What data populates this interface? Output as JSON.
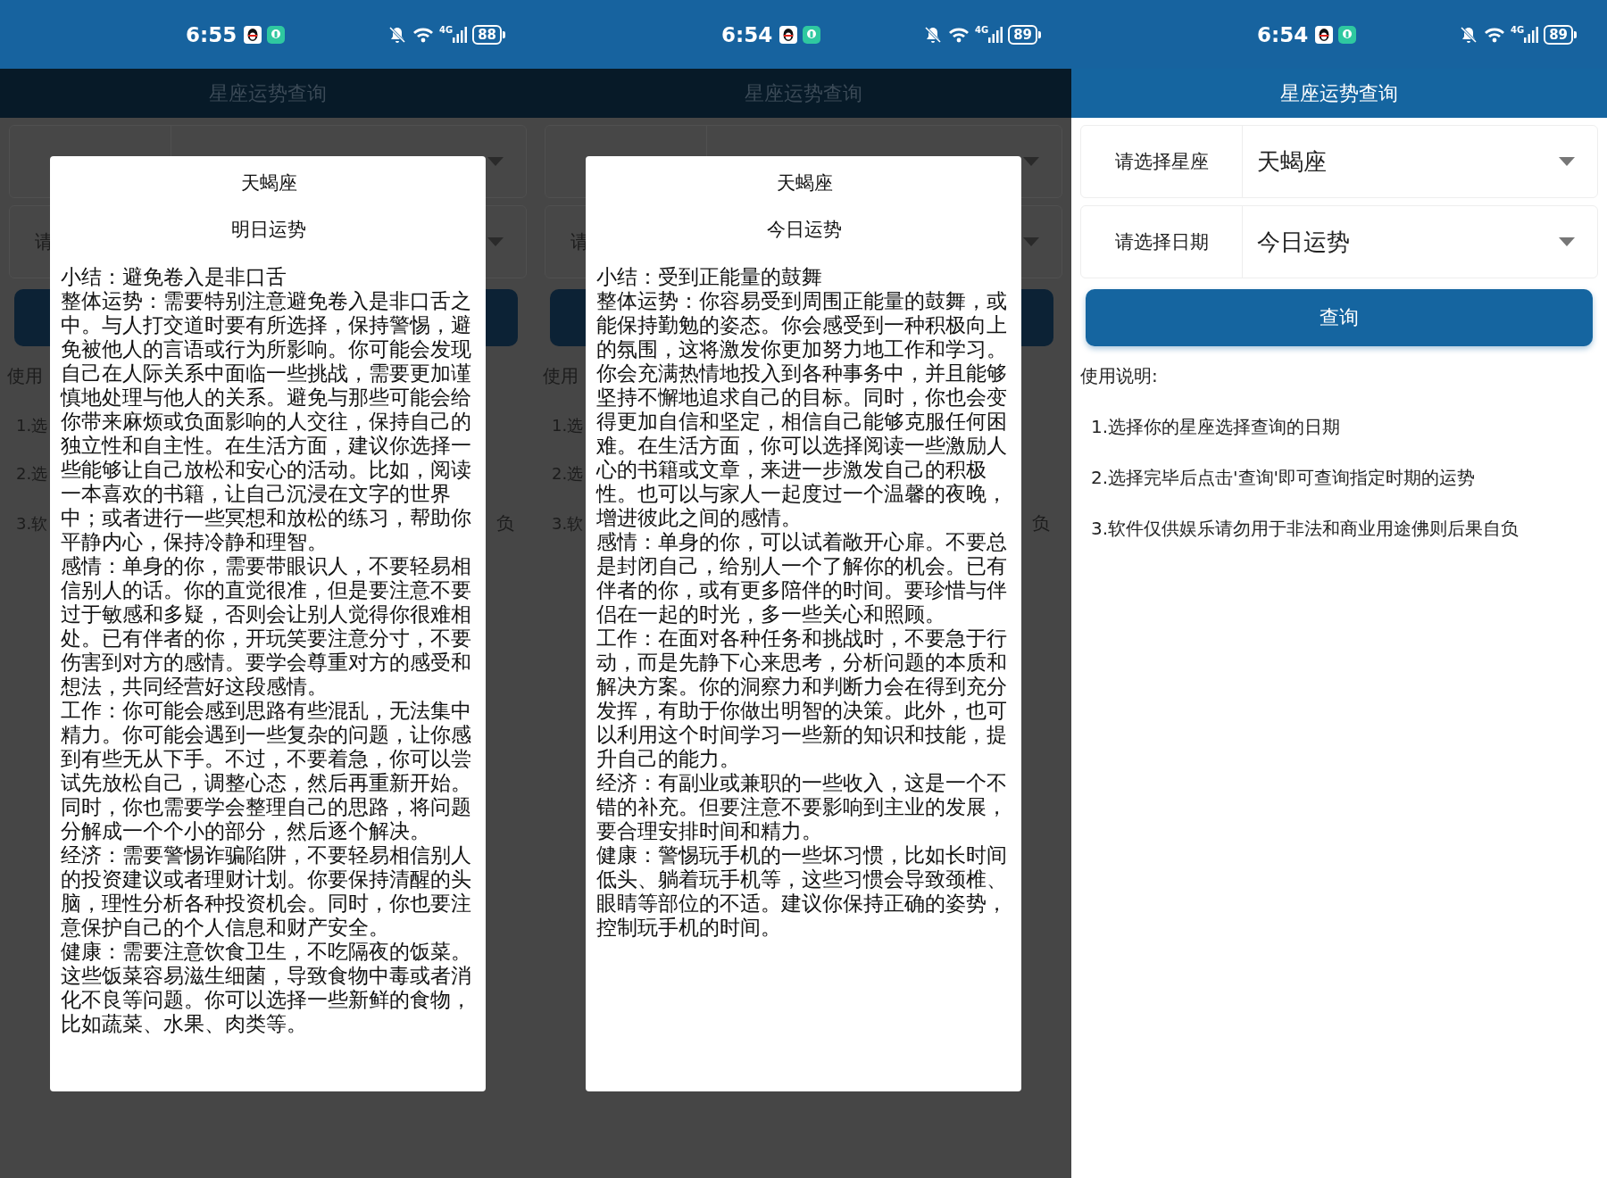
{
  "screens": [
    {
      "kind": "dialog",
      "status_bar": {
        "time": "6:55",
        "network": "4G",
        "battery": "88"
      },
      "header": {
        "title": "星座运势查询"
      },
      "background": {
        "field_fragment": "请",
        "usage_fragment": "使用",
        "item_fragments": [
          "1.选",
          "2.选",
          "3.软"
        ],
        "item_tail": "负"
      },
      "dialog": {
        "title": "天蝎座",
        "period": "明日运势",
        "paragraphs": [
          "小结：避免卷入是非口舌",
          "整体运势：需要特别注意避免卷入是非口舌之中。与人打交道时要有所选择，保持警惕，避免被他人的言语或行为所影响。你可能会发现自己在人际关系中面临一些挑战，需要更加谨慎地处理与他人的关系。避免与那些可能会给你带来麻烦或负面影响的人交往，保持自己的独立性和自主性。在生活方面，建议你选择一些能够让自己放松和安心的活动。比如，阅读一本喜欢的书籍，让自己沉浸在文字的世界中；或者进行一些冥想和放松的练习，帮助你平静内心，保持冷静和理智。",
          "感情：单身的你，需要带眼识人，不要轻易相信别人的话。你的直觉很准，但是要注意不要过于敏感和多疑，否则会让别人觉得你很难相处。已有伴者的你，开玩笑要注意分寸，不要伤害到对方的感情。要学会尊重对方的感受和想法，共同经营好这段感情。",
          "工作：你可能会感到思路有些混乱，无法集中精力。你可能会遇到一些复杂的问题，让你感到有些无从下手。不过，不要着急，你可以尝试先放松自己，调整心态，然后再重新开始。同时，你也需要学会整理自己的思路，将问题分解成一个个小的部分，然后逐个解决。",
          "经济：需要警惕诈骗陷阱，不要轻易相信别人的投资建议或者理财计划。你要保持清醒的头脑，理性分析各种投资机会。同时，你也要注意保护自己的个人信息和财产安全。",
          "健康：需要注意饮食卫生，不吃隔夜的饭菜。这些饭菜容易滋生细菌，导致食物中毒或者消化不良等问题。你可以选择一些新鲜的食物，比如蔬菜、水果、肉类等。"
        ]
      }
    },
    {
      "kind": "dialog",
      "status_bar": {
        "time": "6:54",
        "network": "4G",
        "battery": "89"
      },
      "header": {
        "title": "星座运势查询"
      },
      "background": {
        "field_fragment": "请",
        "usage_fragment": "使用",
        "item_fragments": [
          "1.选",
          "2.选",
          "3.软"
        ],
        "item_tail": "负"
      },
      "dialog": {
        "title": "天蝎座",
        "period": "今日运势",
        "paragraphs": [
          "小结：受到正能量的鼓舞",
          "整体运势：你容易受到周围正能量的鼓舞，或能保持勤勉的姿态。你会感受到一种积极向上的氛围，这将激发你更加努力地工作和学习。你会充满热情地投入到各种事务中，并且能够坚持不懈地追求自己的目标。同时，你也会变得更加自信和坚定，相信自己能够克服任何困难。在生活方面，你可以选择阅读一些激励人心的书籍或文章，来进一步激发自己的积极性。也可以与家人一起度过一个温馨的夜晚，增进彼此之间的感情。",
          "感情：单身的你，可以试着敞开心扉。不要总是封闭自己，给别人一个了解你的机会。已有伴者的你，或有更多陪伴的时间。要珍惜与伴侣在一起的时光，多一些关心和照顾。",
          "工作：在面对各种任务和挑战时，不要急于行动，而是先静下心来思考，分析问题的本质和解决方案。你的洞察力和判断力会在得到充分发挥，有助于你做出明智的决策。此外，也可以利用这个时间学习一些新的知识和技能，提升自己的能力。",
          "经济：有副业或兼职的一些收入，这是一个不错的补充。但要注意不要影响到主业的发展，要合理安排时间和精力。",
          "健康：警惕玩手机的一些坏习惯，比如长时间低头、躺着玩手机等，这些习惯会导致颈椎、眼睛等部位的不适。建议你保持正确的姿势，控制玩手机的时间。"
        ]
      }
    },
    {
      "kind": "form",
      "status_bar": {
        "time": "6:54",
        "network": "4G",
        "battery": "89"
      },
      "header": {
        "title": "星座运势查询"
      },
      "fields": [
        {
          "label": "请选择星座",
          "value": "天蝎座"
        },
        {
          "label": "请选择日期",
          "value": "今日运势"
        }
      ],
      "button": "查询",
      "usage": {
        "title": "使用说明:",
        "items": [
          "1.选择你的星座选择查询的日期",
          "2.选择完毕后点击'查询'即可查询指定时期的运势",
          "3.软件仅供娱乐请勿用于非法和商业用途佛则后果自负"
        ]
      }
    }
  ]
}
